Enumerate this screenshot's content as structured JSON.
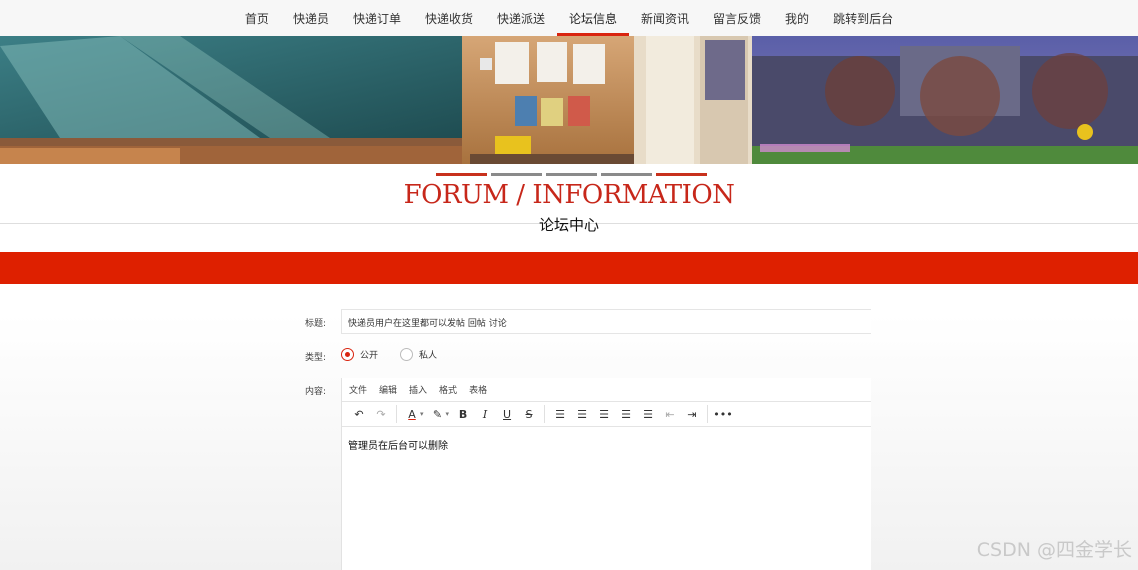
{
  "nav": {
    "items": [
      "首页",
      "快递员",
      "快递订单",
      "快递收货",
      "快递派送",
      "论坛信息",
      "新闻资讯",
      "留言反馈",
      "我的",
      "跳转到后台"
    ],
    "active_index": 5
  },
  "section": {
    "title": "FORUM / INFORMATION",
    "subtitle": "论坛中心"
  },
  "form": {
    "title_label": "标题:",
    "title_value": "快递员用户在这里都可以发帖 回帖 讨论",
    "type_label": "类型:",
    "type_options": [
      "公开",
      "私人"
    ],
    "type_selected": "公开",
    "content_label": "内容:"
  },
  "editor": {
    "menus": [
      "文件",
      "编辑",
      "插入",
      "格式",
      "表格"
    ],
    "content": "管理员在后台可以删除"
  },
  "colors": {
    "accent": "#d9240f",
    "band": "#de2000"
  },
  "watermark": "CSDN @四金学长"
}
